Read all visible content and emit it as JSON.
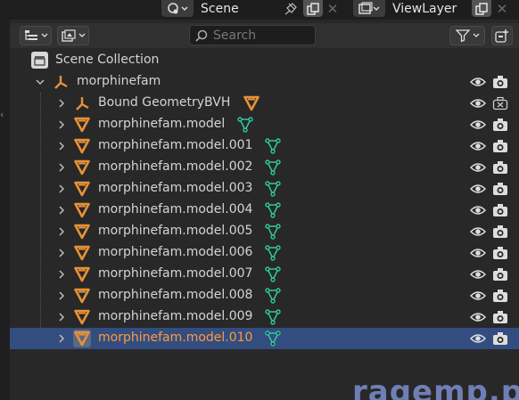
{
  "header": {
    "scene_label": "Scene",
    "view_layer_label": "ViewLayer"
  },
  "toolbar": {
    "search_placeholder": "Search"
  },
  "outliner": {
    "root_label": "Scene Collection",
    "collection_label": "morphinefam",
    "items": [
      {
        "label": "Bound GeometryBVH",
        "type": "empty",
        "data": "mesh-orange",
        "render": "disabled"
      },
      {
        "label": "morphinefam.model",
        "type": "mesh",
        "data": "mesh-data",
        "render": "camera"
      },
      {
        "label": "morphinefam.model.001",
        "type": "mesh",
        "data": "mesh-data",
        "render": "camera"
      },
      {
        "label": "morphinefam.model.002",
        "type": "mesh",
        "data": "mesh-data",
        "render": "camera"
      },
      {
        "label": "morphinefam.model.003",
        "type": "mesh",
        "data": "mesh-data",
        "render": "camera"
      },
      {
        "label": "morphinefam.model.004",
        "type": "mesh",
        "data": "mesh-data",
        "render": "camera"
      },
      {
        "label": "morphinefam.model.005",
        "type": "mesh",
        "data": "mesh-data",
        "render": "camera"
      },
      {
        "label": "morphinefam.model.006",
        "type": "mesh",
        "data": "mesh-data",
        "render": "camera"
      },
      {
        "label": "morphinefam.model.007",
        "type": "mesh",
        "data": "mesh-data",
        "render": "camera"
      },
      {
        "label": "morphinefam.model.008",
        "type": "mesh",
        "data": "mesh-data",
        "render": "camera"
      },
      {
        "label": "morphinefam.model.009",
        "type": "mesh",
        "data": "mesh-data",
        "render": "camera"
      },
      {
        "label": "morphinefam.model.010",
        "type": "mesh",
        "data": "mesh-data",
        "render": "camera",
        "selected": true
      }
    ]
  },
  "watermark": "ragemp.pro",
  "colors": {
    "object_orange": "#e8923a",
    "mesh_data_teal": "#2fc9a0",
    "selection_blue": "#334d80",
    "selected_text": "#ff9a3a"
  }
}
